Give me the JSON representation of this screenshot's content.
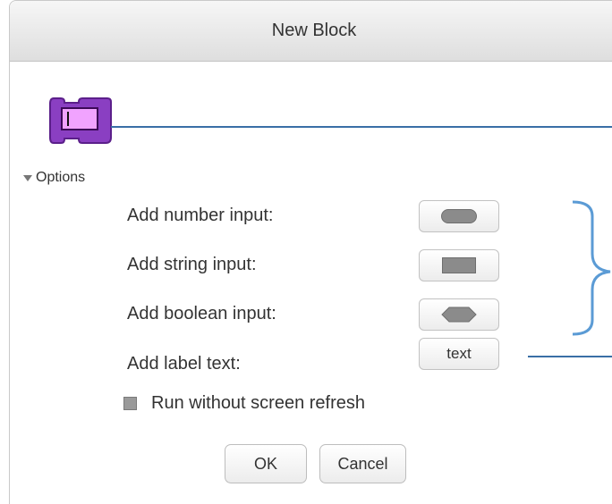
{
  "dialog": {
    "title": "New Block"
  },
  "options": {
    "toggle_label": "Options",
    "rows": [
      {
        "label": "Add number input:",
        "shape": "round-input-shape-icon"
      },
      {
        "label": "Add string input:",
        "shape": "rect-input-shape-icon"
      },
      {
        "label": "Add boolean input:",
        "shape": "hexagon-input-shape-icon"
      },
      {
        "label": "Add label text:",
        "button_text": "text"
      }
    ],
    "run_without_refresh": {
      "label": "Run without screen refresh",
      "checked": false
    }
  },
  "footer": {
    "ok_label": "OK",
    "cancel_label": "Cancel"
  },
  "colors": {
    "block_fill": "#8a3fc2",
    "block_input": "#f1a3ff",
    "annotation": "#3a6fa6",
    "bracket": "#5b9bd5"
  }
}
